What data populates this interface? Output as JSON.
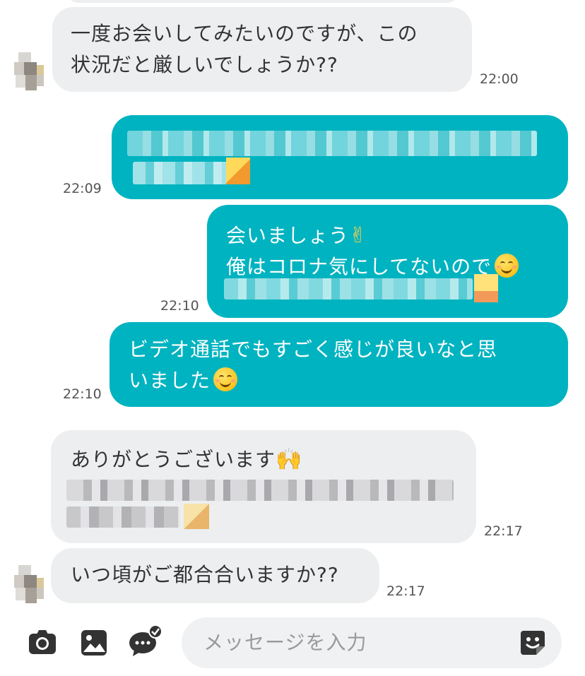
{
  "messages": [
    {
      "id": "m1",
      "side": "incoming",
      "lines": [
        "一度お会いしてみたいのですが、この",
        "状況だと厳しいでしょうか??"
      ],
      "time": "22:00"
    },
    {
      "id": "m2",
      "side": "outgoing",
      "lines": [],
      "pixelated": true,
      "time": "22:09"
    },
    {
      "id": "m3",
      "side": "outgoing",
      "lines": [
        "会いましょう",
        "俺はコロナ気にしてないので"
      ],
      "emoji": [
        "victory-hand",
        "smiling-face"
      ],
      "pixelated_line": true,
      "time": "22:10"
    },
    {
      "id": "m4",
      "side": "outgoing",
      "lines": [
        "ビデオ通話でもすごく感じが良いなと思",
        "いました"
      ],
      "emoji": [
        "smiling-face"
      ],
      "time": "22:10"
    },
    {
      "id": "m5",
      "side": "incoming",
      "lines": [
        "ありがとうございます"
      ],
      "emoji": [
        "raising-hands"
      ],
      "pixelated_lines": 2,
      "time": "22:17"
    },
    {
      "id": "m6",
      "side": "incoming",
      "lines": [
        "いつ頃がご都合合いますか??"
      ],
      "time": "22:17"
    }
  ],
  "composer": {
    "placeholder": "メッセージを入力",
    "icons": [
      "camera-icon",
      "image-icon",
      "chat-check-icon",
      "sticker-icon"
    ]
  },
  "colors": {
    "outgoing_bubble": "#00b3c0",
    "incoming_bubble": "#eceef0",
    "background": "#ffffff"
  }
}
